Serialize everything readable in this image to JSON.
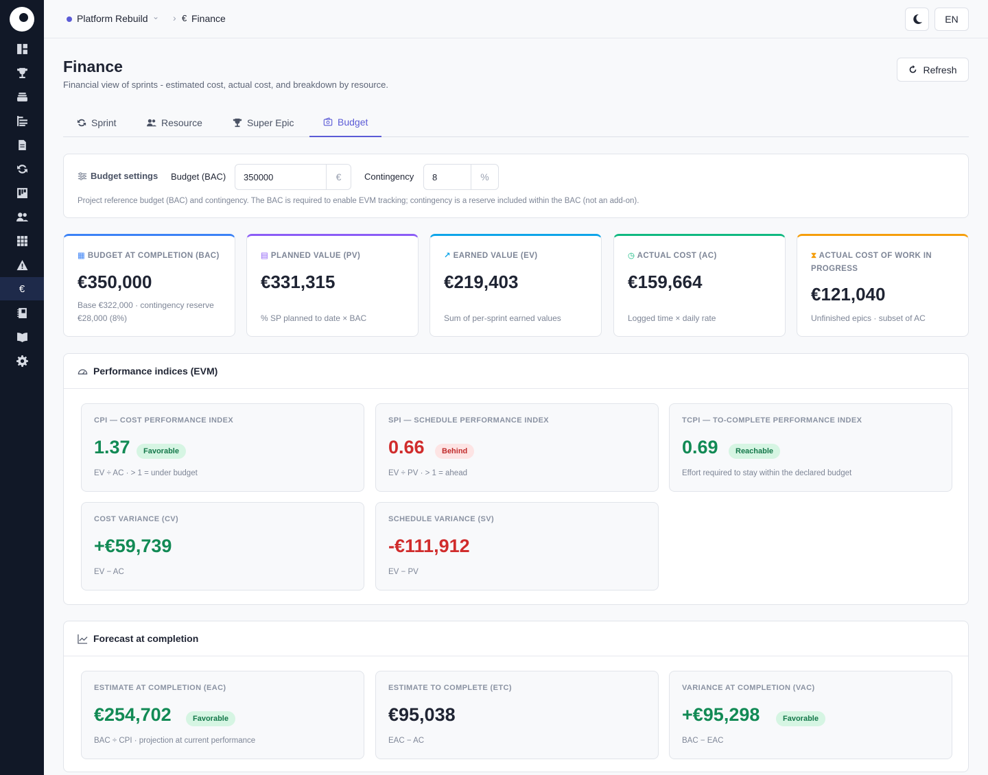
{
  "topbar": {
    "project": "Platform Rebuild",
    "page_euro_icon": "€",
    "page": "Finance",
    "lang": "EN"
  },
  "sidebar": {
    "items": [
      {
        "icon": "dashboard-icon"
      },
      {
        "icon": "trophy-icon"
      },
      {
        "icon": "layers-icon"
      },
      {
        "icon": "tree-list-icon"
      },
      {
        "icon": "document-icon"
      },
      {
        "icon": "sync-icon"
      },
      {
        "icon": "kanban-icon"
      },
      {
        "icon": "users-icon"
      },
      {
        "icon": "grid-icon"
      },
      {
        "icon": "warning-icon"
      },
      {
        "icon": "euro-icon",
        "label": "€",
        "active": true
      },
      {
        "icon": "notebook-icon"
      },
      {
        "icon": "book-icon"
      },
      {
        "icon": "gear-icon"
      }
    ]
  },
  "header": {
    "title": "Finance",
    "subtitle": "Financial view of sprints - estimated cost, actual cost, and breakdown by resource.",
    "refresh_label": "Refresh"
  },
  "tabs": [
    {
      "label": "Sprint"
    },
    {
      "label": "Resource"
    },
    {
      "label": "Super Epic"
    },
    {
      "label": "Budget",
      "active": true
    }
  ],
  "settings": {
    "title": "Budget settings",
    "budget_label": "Budget (BAC)",
    "budget_value": "350000",
    "budget_unit": "€",
    "contingency_label": "Contingency",
    "contingency_value": "8",
    "contingency_unit": "%",
    "note": "Project reference budget (BAC) and contingency. The BAC is required to enable EVM tracking; contingency is a reserve included within the BAC (not an add-on)."
  },
  "kpis": [
    {
      "label": "Budget at completion (BAC)",
      "value": "€350,000",
      "note": "Base €322,000 · contingency reserve €28,000 (8%)",
      "color": "#3b82f6"
    },
    {
      "label": "Planned value (PV)",
      "value": "€331,315",
      "note": "% SP planned to date × BAC",
      "color": "#8b5cf6"
    },
    {
      "label": "Earned value (EV)",
      "value": "€219,403",
      "note": "Sum of per-sprint earned values",
      "color": "#0ea5e9"
    },
    {
      "label": "Actual cost (AC)",
      "value": "€159,664",
      "note": "Logged time × daily rate",
      "color": "#10b981"
    },
    {
      "label": "Actual cost of work in progress",
      "value": "€121,040",
      "note": "Unfinished epics · subset of AC",
      "color": "#f59e0b"
    }
  ],
  "evm": {
    "title": "Performance indices (EVM)",
    "metrics": [
      {
        "label": "CPI — Cost performance index",
        "value": "1.37",
        "badge": "Favorable",
        "note": "EV ÷ AC · > 1 = under budget",
        "tone": "good"
      },
      {
        "label": "SPI — Schedule performance index",
        "value": "0.66",
        "badge": "Behind",
        "note": "EV ÷ PV · > 1 = ahead",
        "tone": "bad"
      },
      {
        "label": "TCPI — To-complete performance index",
        "value": "0.69",
        "badge": "Reachable",
        "note": "Effort required to stay within the declared budget",
        "tone": "good"
      },
      {
        "label": "Cost variance (CV)",
        "value": "+€59,739",
        "note": "EV − AC",
        "tone": "good"
      },
      {
        "label": "Schedule variance (SV)",
        "value": "-€111,912",
        "note": "EV − PV",
        "tone": "bad"
      }
    ]
  },
  "forecast": {
    "title": "Forecast at completion",
    "metrics": [
      {
        "label": "Estimate at completion (EAC)",
        "value": "€254,702",
        "badge": "Favorable",
        "note": "BAC ÷ CPI · projection at current performance",
        "tone": "good"
      },
      {
        "label": "Estimate to complete (ETC)",
        "value": "€95,038",
        "note": "EAC − AC",
        "tone": "neutral"
      },
      {
        "label": "Variance at completion (VAC)",
        "value": "+€95,298",
        "badge": "Favorable",
        "note": "BAC − EAC",
        "tone": "good"
      }
    ]
  }
}
